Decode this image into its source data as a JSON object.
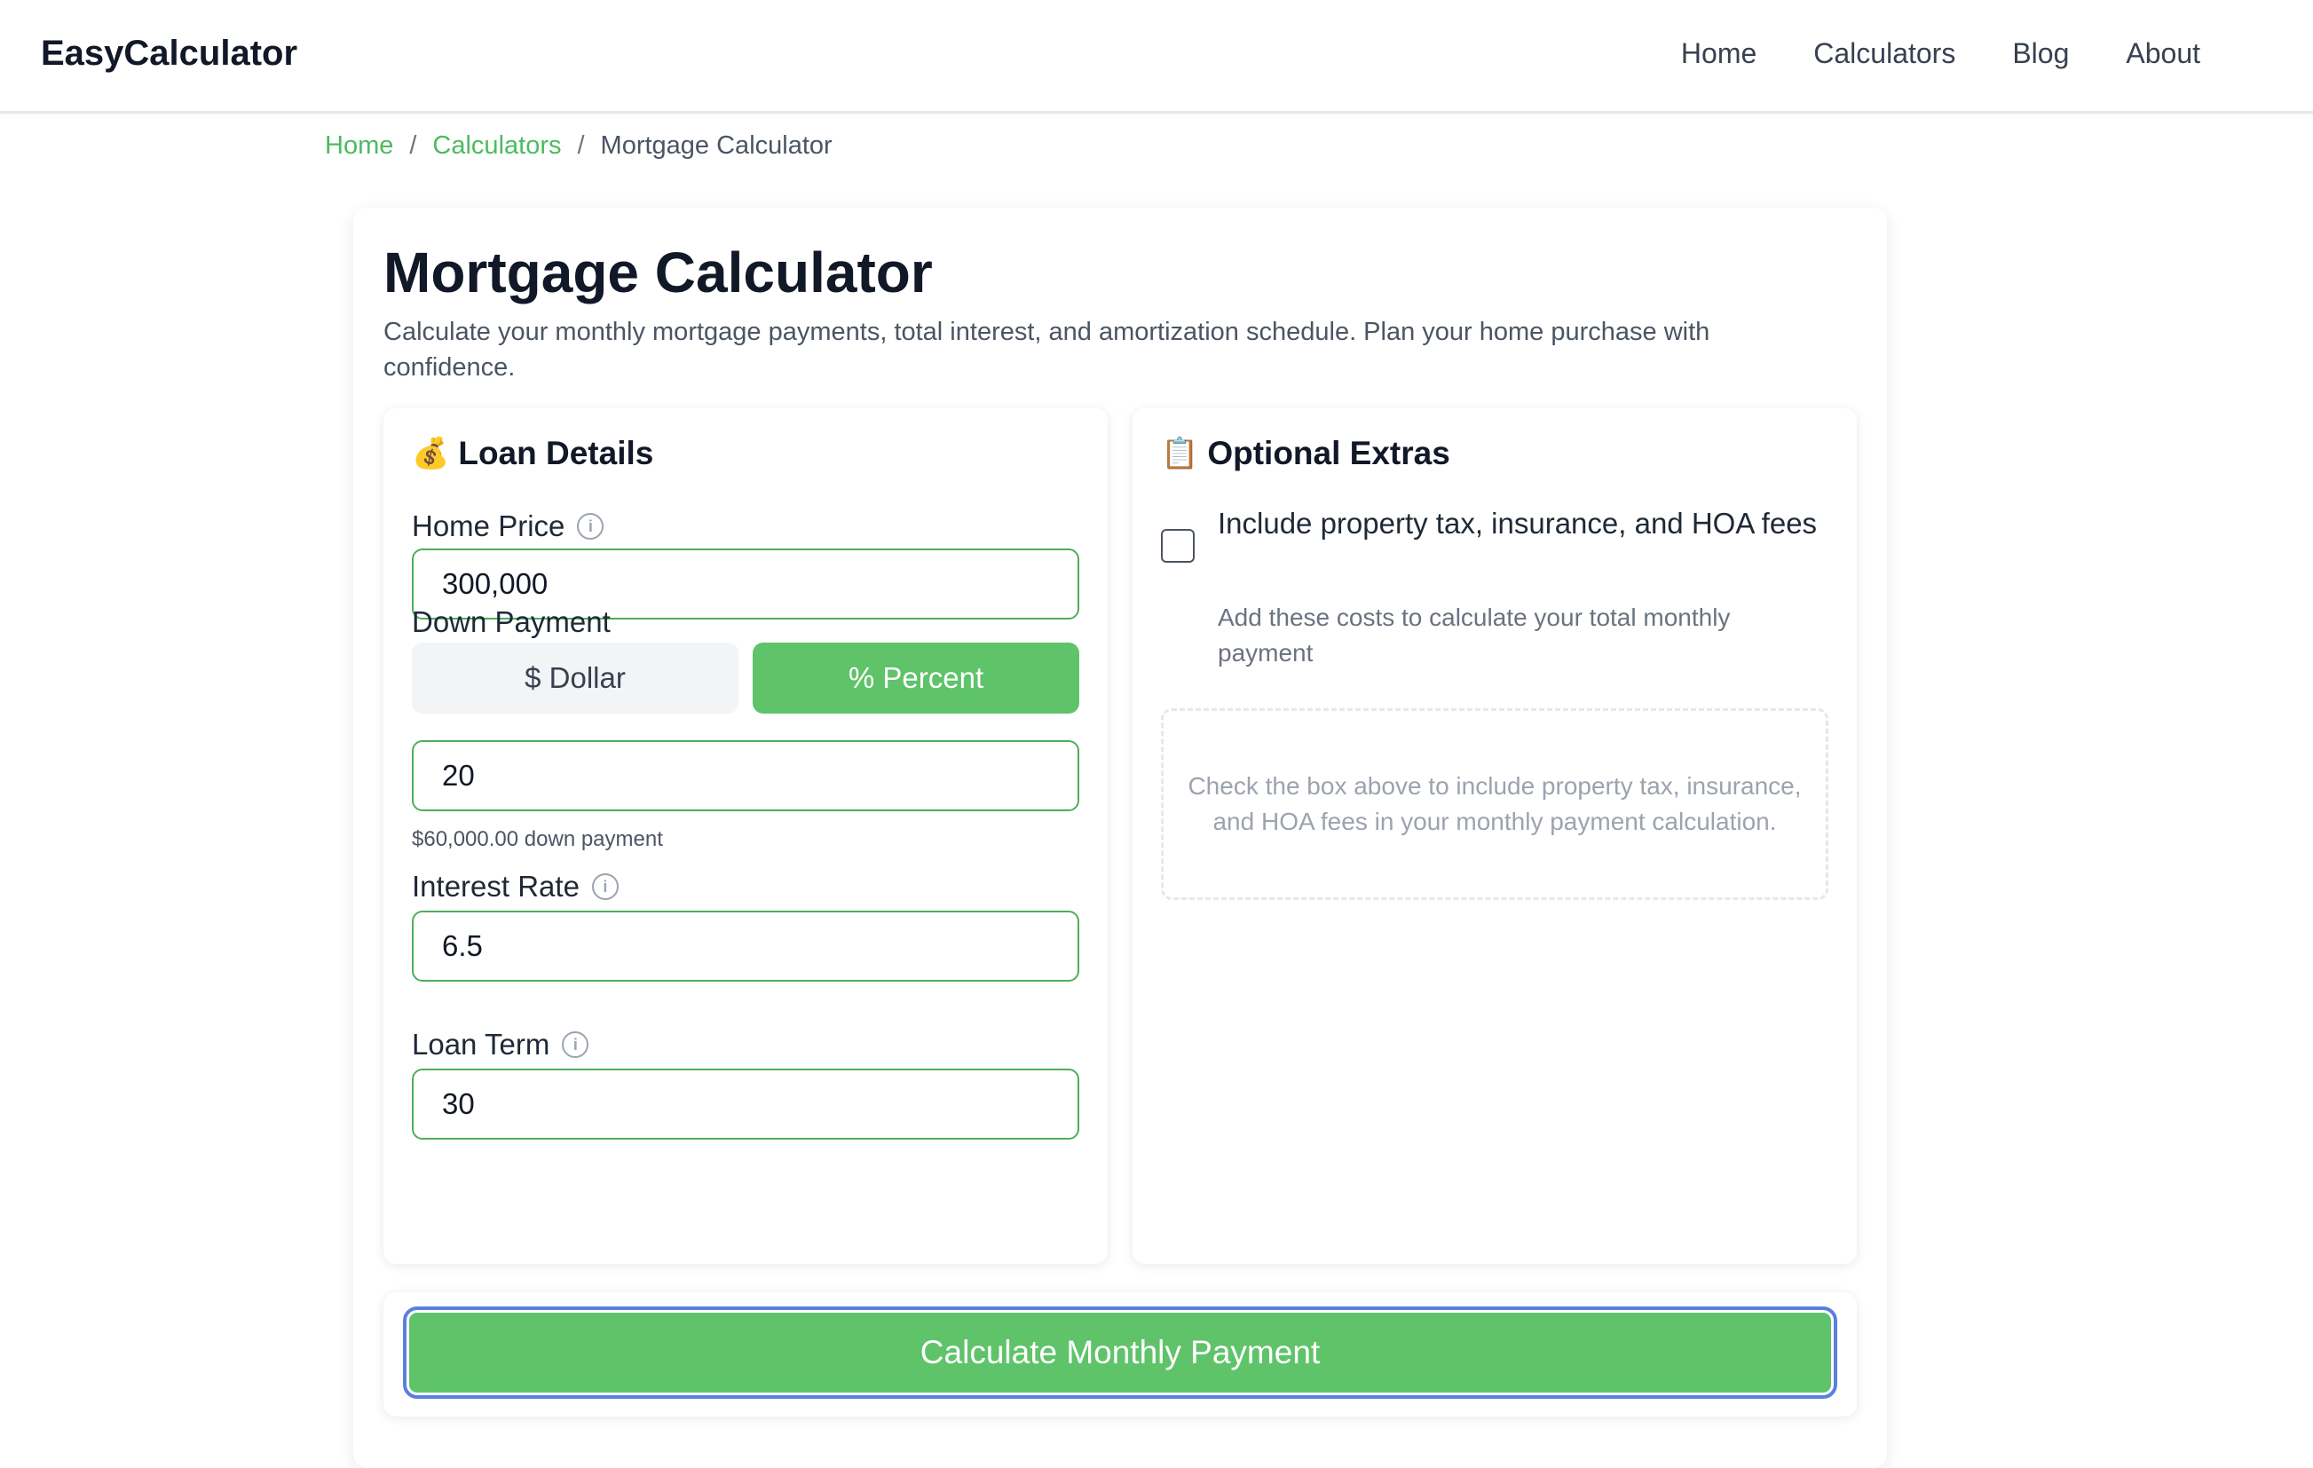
{
  "header": {
    "brand": "EasyCalculator",
    "nav": [
      "Home",
      "Calculators",
      "Blog",
      "About"
    ]
  },
  "breadcrumb": {
    "items": [
      "Home",
      "Calculators"
    ],
    "separator": "/",
    "current": "Mortgage Calculator"
  },
  "page": {
    "title": "Mortgage Calculator",
    "description": "Calculate your monthly mortgage payments, total interest, and amortization schedule. Plan your home purchase with confidence."
  },
  "loan_details": {
    "icon": "money-bag-icon",
    "emoji": "💰",
    "title": "Loan Details",
    "home_price": {
      "label": "Home Price",
      "value": "300,000"
    },
    "down_payment": {
      "label": "Down Payment",
      "dollar_label": "$ Dollar",
      "percent_label": "% Percent",
      "selected": "percent",
      "value": "20",
      "helper": "$60,000.00 down payment"
    },
    "interest_rate": {
      "label": "Interest Rate",
      "value": "6.5"
    },
    "loan_term": {
      "label": "Loan Term",
      "value": "30"
    }
  },
  "optional_extras": {
    "icon": "clipboard-icon",
    "emoji": "📋",
    "title": "Optional Extras",
    "checkbox_label": "Include property tax, insurance, and HOA fees",
    "checkbox_checked": false,
    "checkbox_help": "Add these costs to calculate your total monthly payment",
    "placeholder": "Check the box above to include property tax, insurance, and HOA fees in your monthly payment calculation."
  },
  "actions": {
    "calculate_label": "Calculate Monthly Payment"
  },
  "colors": {
    "accent": "#5fc36a",
    "link": "#4cbb5e",
    "input_border": "#4cae5c",
    "focus_ring": "#5b7fe0"
  },
  "info_glyph": "i"
}
